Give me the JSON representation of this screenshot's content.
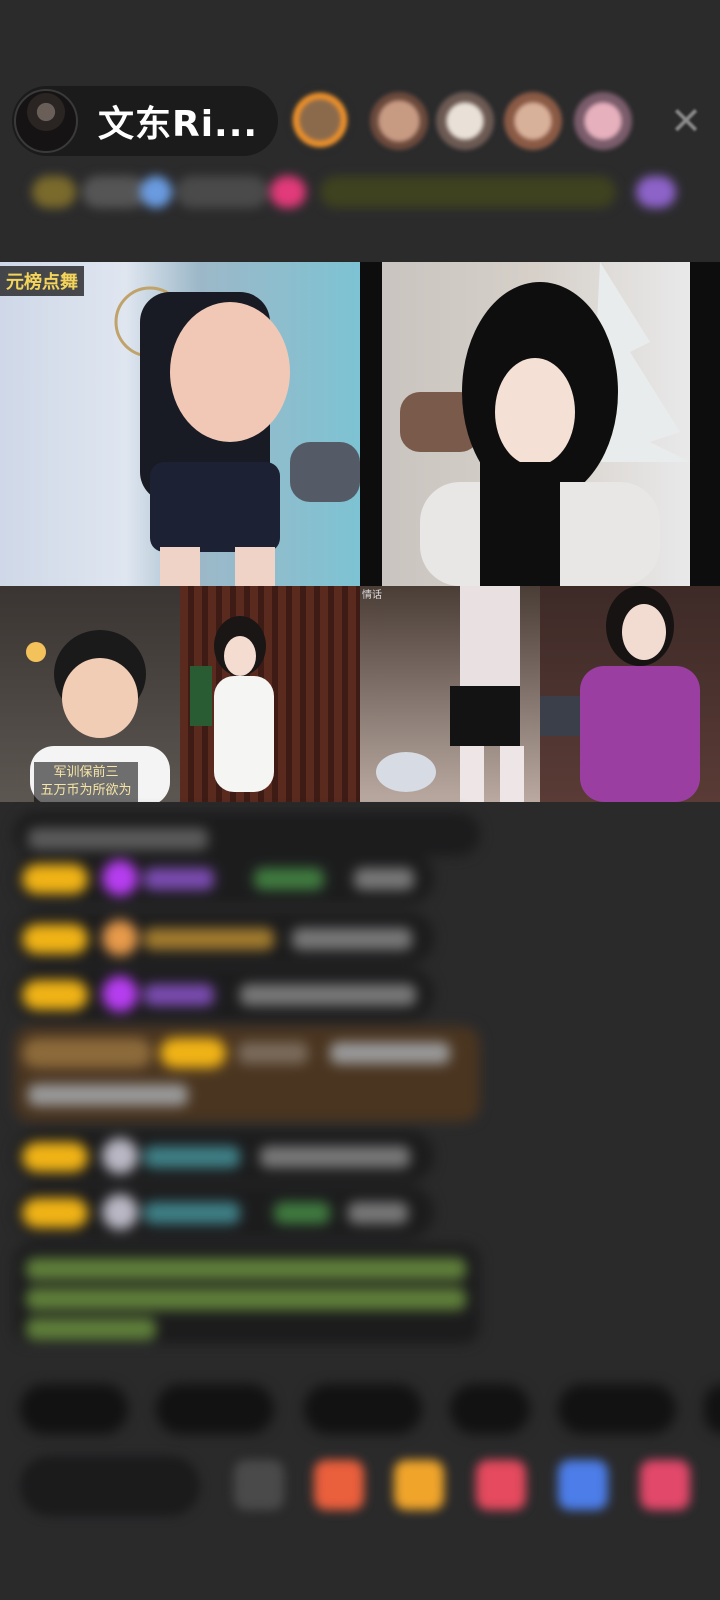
{
  "host": {
    "name": "文东Ri..."
  },
  "grid": {
    "tile1_tag": "元榜点舞",
    "tile2_caption_line1": "军训保前三",
    "tile2_caption_line2": "五万币为所欲为",
    "tile3_tag": "情话"
  },
  "icons": {
    "close": "close-icon"
  },
  "colors": {
    "background": "#2a2a2b",
    "badge_gold": "#f0b316",
    "chat_bubble": "#1c1c1d",
    "tag_yellow": "#f4d45a"
  }
}
